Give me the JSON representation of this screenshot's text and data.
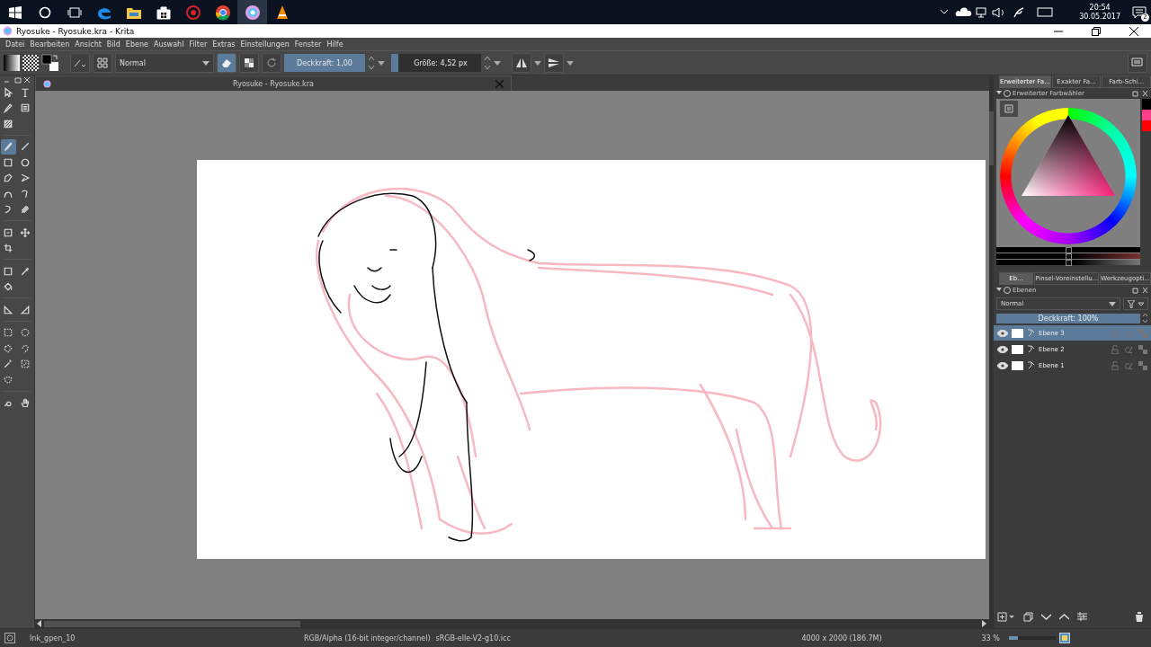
{
  "taskbar": {
    "apps": [
      {
        "kind": "edge",
        "selected": false
      },
      {
        "kind": "folder",
        "selected": false
      },
      {
        "kind": "store",
        "selected": false
      },
      {
        "kind": "red",
        "selected": false
      },
      {
        "kind": "chrome",
        "selected": false
      },
      {
        "kind": "krita",
        "selected": true
      },
      {
        "kind": "cone",
        "selected": false
      }
    ],
    "time": "20:54",
    "date": "30.05.2017",
    "notifications": "2"
  },
  "window": {
    "title": "Ryosuke - Ryosuke.kra  - Krita"
  },
  "menu": [
    "Datei",
    "Bearbeiten",
    "Ansicht",
    "Bild",
    "Ebene",
    "Auswahl",
    "Filter",
    "Extras",
    "Einstellungen",
    "Fenster",
    "Hilfe"
  ],
  "toolbar": {
    "blend_mode": "Normal",
    "eraser_on": true,
    "opacity": {
      "text": "Deckkraft:  1,00",
      "level": 1
    },
    "size": {
      "text": "Größe:  4,52 px",
      "level": 0.08
    }
  },
  "document_tab": {
    "title": "Ryosuke - Ryosuke.kra"
  },
  "tools": [
    [
      {
        "kind": "pointer",
        "selected": false
      },
      {
        "kind": "text",
        "selected": false
      }
    ],
    [
      {
        "kind": "calligraphy",
        "selected": false
      },
      {
        "kind": "list",
        "selected": false
      }
    ],
    [
      {
        "kind": "pattern",
        "selected": false
      }
    ],
    [
      {
        "kind": "brush",
        "selected": true
      },
      {
        "kind": "line",
        "selected": false
      }
    ],
    [
      {
        "kind": "rect",
        "selected": false
      },
      {
        "kind": "ellipse",
        "selected": false
      }
    ],
    [
      {
        "kind": "polygon",
        "selected": false
      },
      {
        "kind": "polyline",
        "selected": false
      }
    ],
    [
      {
        "kind": "bezier",
        "selected": false
      },
      {
        "kind": "path",
        "selected": false
      }
    ],
    [
      {
        "kind": "dynamic",
        "selected": false
      },
      {
        "kind": "multi",
        "selected": false
      }
    ],
    [
      {
        "kind": "transform",
        "selected": false
      },
      {
        "kind": "move",
        "selected": false
      }
    ],
    [
      {
        "kind": "crop",
        "selected": false
      }
    ],
    [
      {
        "kind": "gradient",
        "selected": false
      },
      {
        "kind": "picker",
        "selected": false
      }
    ],
    [
      {
        "kind": "fill",
        "selected": false
      }
    ],
    [
      {
        "kind": "measure",
        "selected": false
      },
      {
        "kind": "assistant",
        "selected": false
      }
    ],
    [
      {
        "kind": "rectsel",
        "selected": false
      },
      {
        "kind": "ellsel",
        "selected": false
      }
    ],
    [
      {
        "kind": "polysel",
        "selected": false
      },
      {
        "kind": "freesel",
        "selected": false
      }
    ],
    [
      {
        "kind": "wand",
        "selected": false
      },
      {
        "kind": "similar",
        "selected": false
      }
    ],
    [
      {
        "kind": "beziersel",
        "selected": false
      }
    ],
    [
      {
        "kind": "zoom",
        "selected": false
      },
      {
        "kind": "hand",
        "selected": false
      }
    ]
  ],
  "docker_tabs_top": [
    {
      "label": "Erweiterter Fa...",
      "selected": true
    },
    {
      "label": "Exakter Fa...",
      "selected": false
    },
    {
      "label": "Farb-Schi...",
      "selected": false
    }
  ],
  "color_panel": {
    "title": "Erweiterter Farbwähler",
    "sliders": [
      {
        "level": 0.5
      },
      {
        "level": 0.5
      },
      {
        "level": 0.5
      }
    ],
    "history": [
      {
        "color": "#000000"
      },
      {
        "color": "#ff3d8b"
      },
      {
        "color": "#ff0000"
      }
    ]
  },
  "docker_tabs_bottom": [
    {
      "label": "Eb...",
      "selected": true
    },
    {
      "label": "Pinsel-Voreinstellu...",
      "selected": false
    },
    {
      "label": "Werkzeugopti...",
      "selected": false
    }
  ],
  "layers_panel": {
    "title": "Ebenen",
    "blend_mode": "Normal",
    "opacity": {
      "text": "Deckkraft:  100%",
      "level": 1
    },
    "layers": [
      {
        "name": "Ebene 3",
        "selected": true,
        "visible": true
      },
      {
        "name": "Ebene 2",
        "selected": false,
        "visible": true
      },
      {
        "name": "Ebene 1",
        "selected": false,
        "visible": true
      }
    ]
  },
  "status_bar": {
    "brush": "Ink_gpen_10",
    "color_model": "RGB/Alpha (16-bit integer/channel)",
    "profile": "sRGB-elle-V2-g10.icc",
    "image_size": "4000 x 2000 (186.7M)",
    "zoom": "33 %",
    "zoom_slider": {
      "level": 0.2
    }
  }
}
